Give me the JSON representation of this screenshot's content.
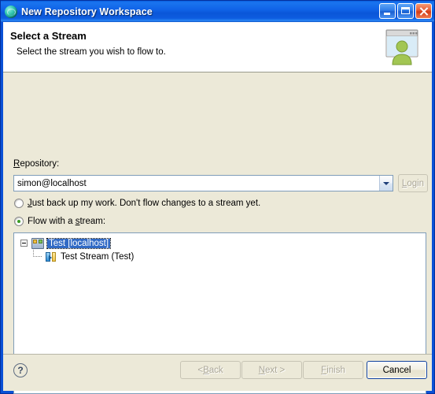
{
  "window": {
    "title": "New Repository Workspace",
    "icon": "globe-icon",
    "controls": {
      "minimize": "Minimize",
      "maximize": "Maximize",
      "close": "Close"
    }
  },
  "banner": {
    "title": "Select a Stream",
    "subtitle": "Select the stream you wish to flow to.",
    "icon": "user-window-icon"
  },
  "form": {
    "repository_label_pre": "R",
    "repository_label_post": "epository:",
    "repository_value": "simon@localhost",
    "repository_placeholder": "",
    "login_label_pre": "L",
    "login_label_post": "ogin",
    "radios": [
      {
        "pre": "",
        "mnemonic": "J",
        "post": "ust back up my work. Don't flow changes to a stream yet.",
        "checked": false
      },
      {
        "pre": "Flow with a ",
        "mnemonic": "s",
        "post": "tream:",
        "checked": true
      }
    ]
  },
  "tree": {
    "nodes": [
      {
        "label": "Test [localhost]",
        "icon": "repository-icon",
        "selected": true,
        "expanded": true
      },
      {
        "label": "Test Stream (Test)",
        "icon": "stream-icon",
        "selected": false
      }
    ]
  },
  "footer": {
    "help": "?",
    "buttons": [
      {
        "pre": "< ",
        "mnemonic": "B",
        "post": "ack",
        "enabled": false
      },
      {
        "pre": "",
        "mnemonic": "N",
        "post": "ext >",
        "enabled": false
      },
      {
        "pre": "",
        "mnemonic": "F",
        "post": "inish",
        "enabled": false
      },
      {
        "pre": "Cancel",
        "mnemonic": "",
        "post": "",
        "enabled": true
      }
    ]
  },
  "colors": {
    "title_bar": "#0a56d8",
    "dialog_bg": "#ece9d8",
    "selection": "#316ac5",
    "radio_dot": "#3a9c24",
    "close_button": "#d23b16"
  }
}
